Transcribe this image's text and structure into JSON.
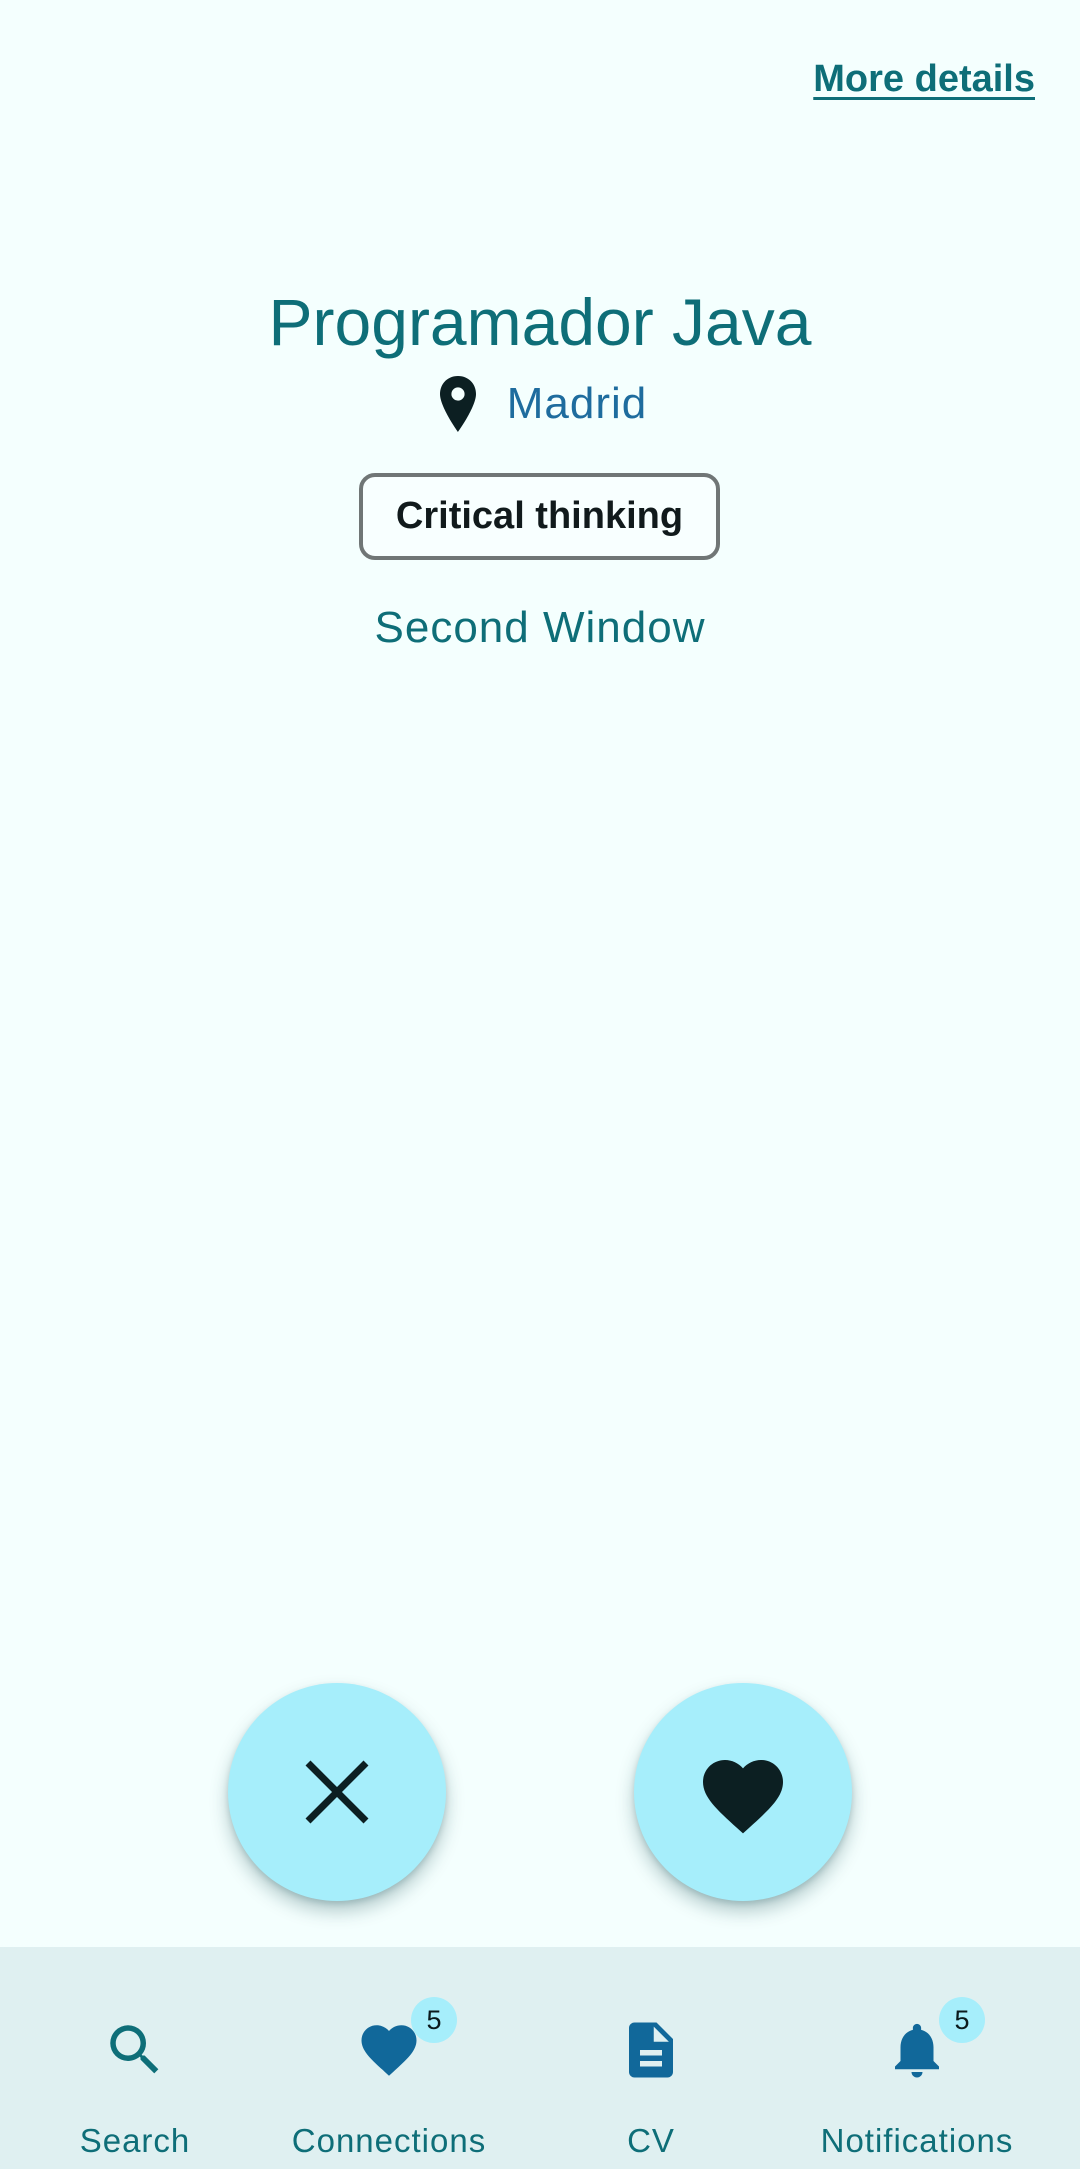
{
  "header": {
    "more_details_label": "More details"
  },
  "offer": {
    "title": "Programador Java",
    "location": "Madrid",
    "location_icon": "location-pin-icon",
    "skills": [
      "Critical thinking"
    ],
    "second_window_label": "Second Window"
  },
  "actions": {
    "dismiss_icon": "close-icon",
    "like_icon": "heart-icon",
    "fab_color": "#A6EEFB"
  },
  "bottom_nav": {
    "items": [
      {
        "label": "Search",
        "icon": "search-icon"
      },
      {
        "label": "Connections",
        "icon": "heart-icon",
        "badge": "5"
      },
      {
        "label": "CV",
        "icon": "document-icon"
      },
      {
        "label": "Notifications",
        "icon": "bell-icon",
        "badge": "5"
      }
    ]
  },
  "colors": {
    "background": "#F4FFFE",
    "accent": "#0E6E78",
    "location_text": "#1E6C9E",
    "nav_background": "#DFF0F1",
    "badge": "#A6EEFB"
  }
}
